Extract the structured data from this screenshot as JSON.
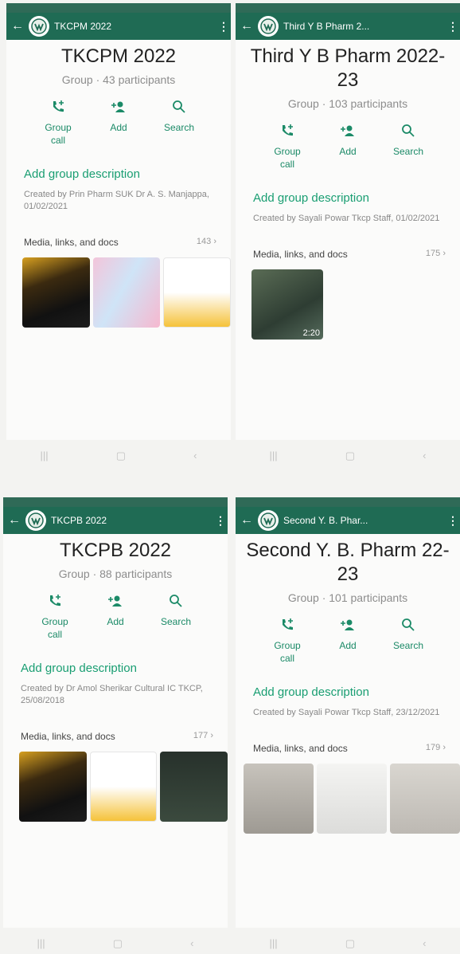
{
  "panels": [
    {
      "appbar_title": "TKCPM 2022",
      "group_name": "TKCPM 2022",
      "participants": "Group · 43 participants",
      "actions": {
        "call": "Group call",
        "add": "Add",
        "search": "Search"
      },
      "add_description": "Add group description",
      "created_by": "Created by Prin Pharm SUK Dr A. S. Manjappa, 01/02/2021",
      "media_label": "Media, links, and docs",
      "media_count": "143 ›",
      "video_duration": ""
    },
    {
      "appbar_title": "Third Y B Pharm 2...",
      "group_name": "Third Y B Pharm 2022-23",
      "participants": "Group · 103 participants",
      "actions": {
        "call": "Group call",
        "add": "Add",
        "search": "Search"
      },
      "add_description": "Add group description",
      "created_by": "Created by Sayali Powar Tkcp Staff, 01/02/2021",
      "media_label": "Media, links, and docs",
      "media_count": "175 ›",
      "video_duration": "2:20"
    },
    {
      "appbar_title": "TKCPB 2022",
      "group_name": "TKCPB 2022",
      "participants": "Group · 88 participants",
      "actions": {
        "call": "Group call",
        "add": "Add",
        "search": "Search"
      },
      "add_description": "Add group description",
      "created_by": "Created by Dr Amol Sherikar Cultural IC TKCP, 25/08/2018",
      "media_label": "Media, links, and docs",
      "media_count": "177 ›",
      "video_duration": ""
    },
    {
      "appbar_title": "Second Y. B. Phar...",
      "group_name": "Second Y. B. Pharm 22-23",
      "participants": "Group · 101 participants",
      "actions": {
        "call": "Group call",
        "add": "Add",
        "search": "Search"
      },
      "add_description": "Add group description",
      "created_by": "Created by Sayali Powar Tkcp Staff, 23/12/2021",
      "media_label": "Media, links, and docs",
      "media_count": "179 ›",
      "video_duration": ""
    }
  ],
  "nav": {
    "recents": "|||",
    "home": "▢",
    "back": "‹"
  },
  "colors": {
    "appbar": "#1f6b54",
    "accent": "#199e72"
  }
}
